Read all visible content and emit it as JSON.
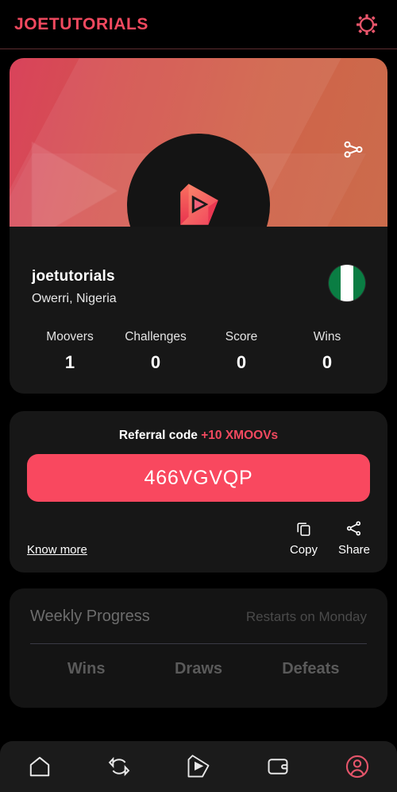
{
  "header": {
    "brand": "JOETUTORIALS",
    "settings_icon": "gear-icon"
  },
  "profile": {
    "banner": {
      "share_icon": "share-icon",
      "watermark_icon": "play-triangle-watermark"
    },
    "avatar_icon": "moov-play-logo",
    "username": "joetutorials",
    "location": "Owerri, Nigeria",
    "country_flag": "nigeria-flag",
    "stats": [
      {
        "label": "Moovers",
        "value": "1"
      },
      {
        "label": "Challenges",
        "value": "0"
      },
      {
        "label": "Score",
        "value": "0"
      },
      {
        "label": "Wins",
        "value": "0"
      }
    ]
  },
  "referral": {
    "title": "Referral code",
    "bonus": "+10 XMOOVs",
    "code": "466VGVQP",
    "know_more": "Know more",
    "copy_label": "Copy",
    "copy_icon": "copy-icon",
    "share_label": "Share",
    "share_icon": "share-icon"
  },
  "weekly": {
    "title": "Weekly Progress",
    "restart_note": "Restarts on Monday",
    "columns": [
      "Wins",
      "Draws",
      "Defeats"
    ]
  },
  "nav": [
    {
      "name": "home",
      "icon": "home-icon",
      "active": false
    },
    {
      "name": "swap",
      "icon": "swap-arrows-icon",
      "active": false
    },
    {
      "name": "moov",
      "icon": "play-logo-icon",
      "active": false
    },
    {
      "name": "wallet",
      "icon": "wallet-icon",
      "active": false
    },
    {
      "name": "profile",
      "icon": "profile-icon",
      "active": true
    }
  ],
  "colors": {
    "accent": "#f2495f",
    "pill": "#f9485f",
    "card": "#171717",
    "background": "#000000"
  }
}
